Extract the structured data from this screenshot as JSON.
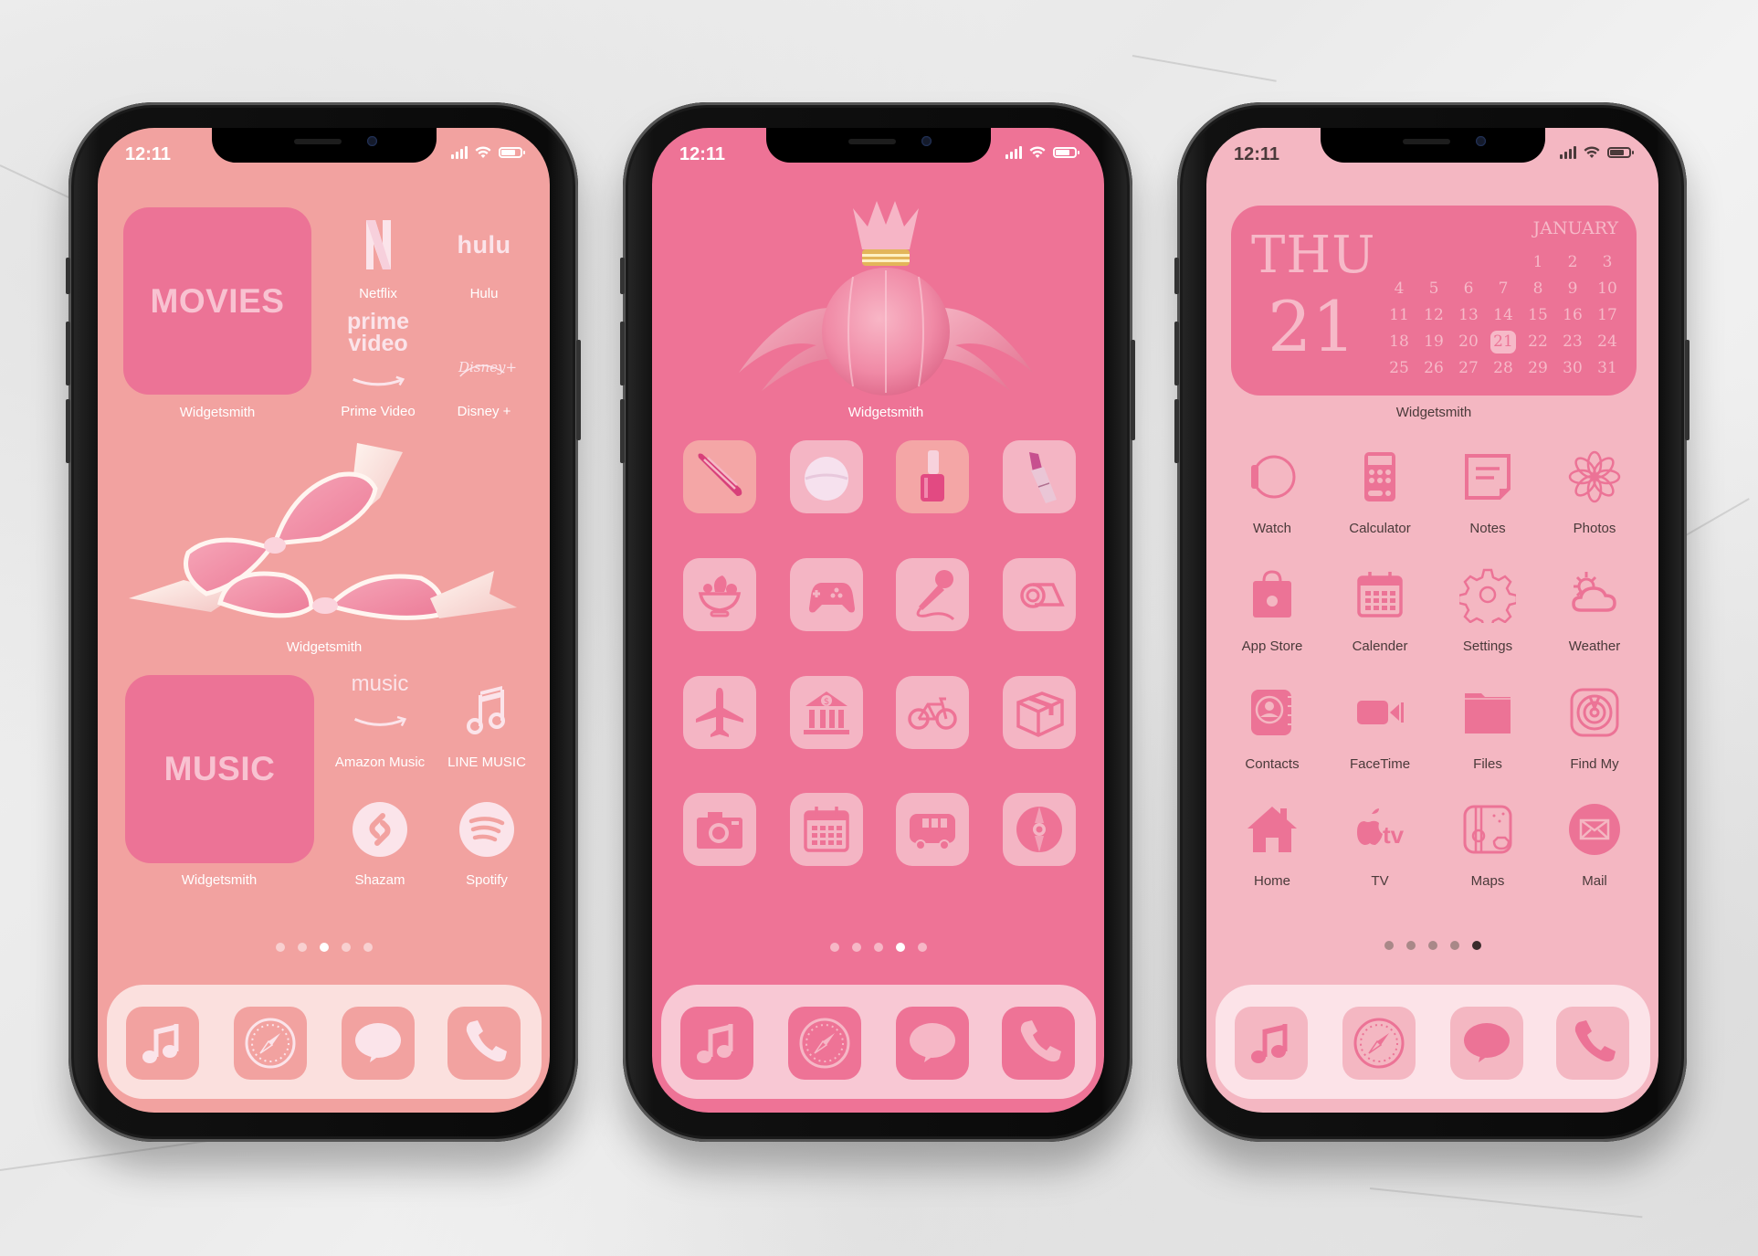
{
  "colors": {
    "background": "#ededed",
    "phone1_wallpaper": "#f2a2a0",
    "phone1_widget": "#ec7396",
    "phone1_text": "#fbe4ea",
    "phone1_dock": "#fbe0de",
    "phone2_wallpaper": "#ee7396",
    "phone2_tile": "#f4b5c4",
    "phone2_dock": "#f8c8d4",
    "phone3_wallpaper": "#f4b7c2",
    "phone3_accent": "#ec7396",
    "phone3_text": "#4a3a3a",
    "phone3_dock": "#fce3e8"
  },
  "phones": [
    {
      "status": {
        "time": "12:11"
      },
      "widgets": [
        {
          "text": "MOVIES",
          "label": "Widgetsmith"
        },
        {
          "image": "satin-ribbon-bows",
          "label": "Widgetsmith"
        },
        {
          "text": "MUSIC",
          "label": "Widgetsmith"
        }
      ],
      "apps": [
        {
          "name": "Netflix",
          "icon": "netflix-icon",
          "glyph": "N"
        },
        {
          "name": "Hulu",
          "icon": "hulu-icon",
          "glyph": "hulu"
        },
        {
          "name": "Prime Video",
          "icon": "prime-video-icon",
          "glyph_top": "prime",
          "glyph_bottom": "video"
        },
        {
          "name": "Disney +",
          "icon": "disney-plus-icon",
          "glyph": "Disney+"
        },
        {
          "name": "Amazon Music",
          "icon": "amazon-music-icon",
          "glyph": "music"
        },
        {
          "name": "LINE MUSIC",
          "icon": "music-notes-icon"
        },
        {
          "name": "Shazam",
          "icon": "shazam-icon"
        },
        {
          "name": "Spotify",
          "icon": "spotify-icon"
        }
      ],
      "page_dots": {
        "count": 5,
        "active": 3
      },
      "dock": [
        "music-icon",
        "safari-compass-icon",
        "messages-icon",
        "phone-icon"
      ]
    },
    {
      "status": {
        "time": "12:11"
      },
      "widgets": [
        {
          "image": "winged-perfume-bottle",
          "label": "Widgetsmith"
        }
      ],
      "apps": [
        {
          "icon": "hair-clip-icon"
        },
        {
          "icon": "powder-puff-icon"
        },
        {
          "icon": "nail-polish-icon"
        },
        {
          "icon": "lipstick-icon"
        },
        {
          "icon": "salad-bowl-icon"
        },
        {
          "icon": "game-controller-icon"
        },
        {
          "icon": "microphone-icon"
        },
        {
          "icon": "yoga-mat-icon"
        },
        {
          "icon": "airplane-icon"
        },
        {
          "icon": "bank-icon"
        },
        {
          "icon": "bicycle-icon"
        },
        {
          "icon": "package-box-icon"
        },
        {
          "icon": "camera-icon"
        },
        {
          "icon": "calendar-icon"
        },
        {
          "icon": "bus-icon"
        },
        {
          "icon": "cd-disc-icon"
        }
      ],
      "page_dots": {
        "count": 5,
        "active": 4
      },
      "dock": [
        "music-icon",
        "safari-compass-icon",
        "messages-icon",
        "phone-icon"
      ]
    },
    {
      "status": {
        "time": "12:11"
      },
      "calendar_widget": {
        "weekday": "THU",
        "day": "21",
        "month": "JANUARY",
        "days": [
          "",
          "",
          "",
          "",
          "1",
          "2",
          "3",
          "4",
          "5",
          "6",
          "7",
          "8",
          "9",
          "10",
          "11",
          "12",
          "13",
          "14",
          "15",
          "16",
          "17",
          "18",
          "19",
          "20",
          "21",
          "22",
          "23",
          "24",
          "25",
          "26",
          "27",
          "28",
          "29",
          "30",
          "31"
        ],
        "selected": "21",
        "label": "Widgetsmith"
      },
      "apps": [
        {
          "name": "Watch",
          "icon": "watch-icon"
        },
        {
          "name": "Calculator",
          "icon": "calculator-icon"
        },
        {
          "name": "Notes",
          "icon": "notes-icon"
        },
        {
          "name": "Photos",
          "icon": "photos-flower-icon"
        },
        {
          "name": "App Store",
          "icon": "app-store-bag-icon"
        },
        {
          "name": "Calender",
          "icon": "calendar-icon"
        },
        {
          "name": "Settings",
          "icon": "settings-gear-icon"
        },
        {
          "name": "Weather",
          "icon": "weather-icon"
        },
        {
          "name": "Contacts",
          "icon": "contacts-icon"
        },
        {
          "name": "FaceTime",
          "icon": "facetime-camera-icon"
        },
        {
          "name": "Files",
          "icon": "files-folder-icon"
        },
        {
          "name": "Find My",
          "icon": "find-my-icon"
        },
        {
          "name": "Home",
          "icon": "home-icon"
        },
        {
          "name": "TV",
          "icon": "apple-tv-icon",
          "glyph": "tv"
        },
        {
          "name": "Maps",
          "icon": "maps-icon"
        },
        {
          "name": "Mail",
          "icon": "mail-icon"
        }
      ],
      "page_dots": {
        "count": 5,
        "active": 5
      },
      "dock": [
        "music-icon",
        "safari-compass-icon",
        "messages-icon",
        "phone-icon"
      ]
    }
  ]
}
